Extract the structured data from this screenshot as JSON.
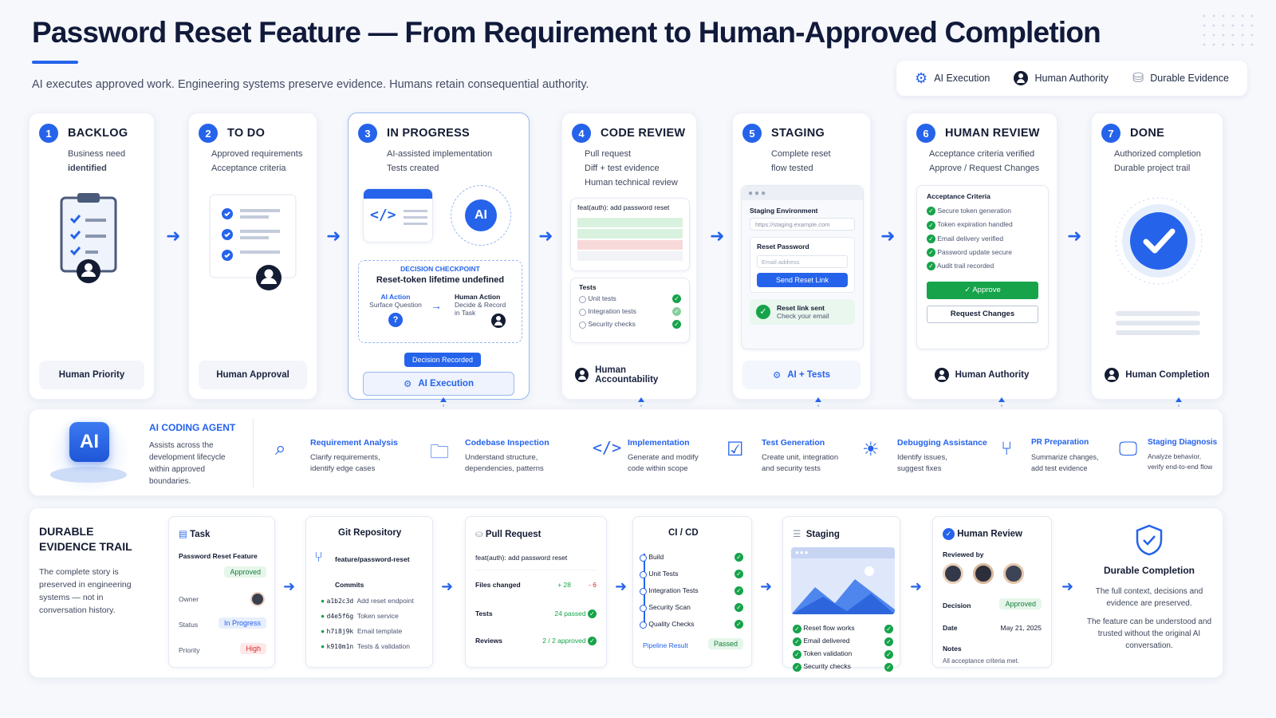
{
  "header": {
    "title": "Password Reset Feature — From Requirement to Human-Approved Completion",
    "subtitle": "AI executes approved work. Engineering systems preserve evidence. Humans retain consequential authority."
  },
  "legend": {
    "ai": "AI Execution",
    "human": "Human Authority",
    "evidence": "Durable Evidence"
  },
  "stages": {
    "backlog": {
      "num": "1",
      "title": "BACKLOG",
      "desc1": "Business need",
      "desc2": "identified",
      "footer": "Human Priority"
    },
    "todo": {
      "num": "2",
      "title": "TO DO",
      "desc1": "Approved requirements",
      "desc2": "Acceptance criteria",
      "footer": "Human Approval"
    },
    "progress": {
      "num": "3",
      "title": "IN PROGRESS",
      "desc1": "AI-assisted implementation",
      "desc2": "Tests created",
      "ai_badge": "AI",
      "cp_label": "DECISION CHECKPOINT",
      "cp_title": "Reset-token lifetime undefined",
      "ai_action": "AI Action",
      "ai_action_desc": "Surface Question",
      "human_action": "Human Action",
      "human_action_desc1": "Decide & Record",
      "human_action_desc2": "in Task",
      "recorded": "Decision Recorded",
      "footer": "AI Execution"
    },
    "review": {
      "num": "4",
      "title": "CODE REVIEW",
      "desc1": "Pull request",
      "desc2": "Diff + test evidence",
      "desc3": "Human technical review",
      "pr_title": "feat(auth): add password reset",
      "tests_label": "Tests",
      "t1": "Unit tests",
      "t2": "Integration tests",
      "t3": "Security checks",
      "footer": "Human Accountability"
    },
    "staging": {
      "num": "5",
      "title": "STAGING",
      "desc1": "Complete reset",
      "desc2": "flow tested",
      "env": "Staging Environment",
      "url": "https://staging.example.com",
      "form_title": "Reset Password",
      "email_ph": "Email address",
      "btn": "Send Reset Link",
      "sent": "Reset link sent",
      "check": "Check your email",
      "footer": "AI + Tests"
    },
    "human": {
      "num": "6",
      "title": "HUMAN REVIEW",
      "desc1": "Acceptance criteria verified",
      "desc2": "Approve / Request Changes",
      "ac_title": "Acceptance Criteria",
      "items": [
        "Secure token generation",
        "Token expiration handled",
        "Email delivery verified",
        "Password update secure",
        "Audit trail recorded"
      ],
      "approve": "Approve",
      "request": "Request Changes",
      "footer": "Human Authority"
    },
    "done": {
      "num": "7",
      "title": "DONE",
      "desc1": "Authorized completion",
      "desc2": "Durable project trail",
      "footer": "Human Completion"
    }
  },
  "agent": {
    "badge": "AI",
    "title": "AI CODING AGENT",
    "desc": "Assists across the development lifecycle within approved boundaries.",
    "caps": [
      {
        "icon": "search-icon",
        "title": "Requirement Analysis",
        "d1": "Clarify requirements,",
        "d2": "identify edge cases"
      },
      {
        "icon": "folder-search-icon",
        "title": "Codebase Inspection",
        "d1": "Understand structure,",
        "d2": "dependencies, patterns"
      },
      {
        "icon": "code-icon",
        "title": "Implementation",
        "d1": "Generate and modify",
        "d2": "code within scope"
      },
      {
        "icon": "checklist-icon",
        "title": "Test Generation",
        "d1": "Create unit, integration",
        "d2": "and security tests"
      },
      {
        "icon": "bug-icon",
        "title": "Debugging Assistance",
        "d1": "Identify issues,",
        "d2": "suggest fixes"
      },
      {
        "icon": "branch-icon",
        "title": "PR Preparation",
        "d1": "Summarize changes,",
        "d2": "add test evidence"
      },
      {
        "icon": "monitor-icon",
        "title": "Staging Diagnosis",
        "d1": "Analyze behavior,",
        "d2": "verify end-to-end flow"
      }
    ]
  },
  "trail": {
    "title1": "DURABLE",
    "title2": "EVIDENCE TRAIL",
    "desc": "The complete story is preserved in engineering systems — not in conversation history.",
    "task": {
      "h": "Task",
      "name": "Password Reset Feature",
      "approved": "Approved",
      "owner": "Owner",
      "status": "Status",
      "status_v": "In Progress",
      "priority": "Priority",
      "priority_v": "High"
    },
    "git": {
      "h": "Git Repository",
      "branch": "feature/password-reset",
      "commits": "Commits",
      "list": [
        [
          "a1b2c3d",
          "Add reset endpoint"
        ],
        [
          "d4e5f6g",
          "Token service"
        ],
        [
          "h7i8j9k",
          "Email template"
        ],
        [
          "k910m1n",
          "Tests & validation"
        ]
      ]
    },
    "pr": {
      "h": "Pull Request",
      "t": "feat(auth): add password reset",
      "files": "Files changed",
      "plus": "+ 28",
      "minus": "- 6",
      "tests": "Tests",
      "tests_v": "24 passed",
      "reviews": "Reviews",
      "reviews_v": "2 / 2 approved"
    },
    "ci": {
      "h": "CI / CD",
      "steps": [
        "Build",
        "Unit Tests",
        "Integration Tests",
        "Security Scan",
        "Quality Checks"
      ],
      "result": "Pipeline Result",
      "passed": "Passed"
    },
    "stg": {
      "h": "Staging",
      "checks": [
        "Reset flow works",
        "Email delivered",
        "Token validation",
        "Security checks"
      ]
    },
    "hr": {
      "h": "Human Review",
      "by": "Reviewed by",
      "decision": "Decision",
      "decision_v": "Approved",
      "date": "Date",
      "date_v": "May 21, 2025",
      "notes": "Notes",
      "notes_v": "All acceptance criteria met."
    },
    "dc": {
      "h": "Durable Completion",
      "d1": "The full context, decisions and evidence are preserved.",
      "d2": "The feature can be understood and trusted without the original AI conversation."
    }
  },
  "colors": {
    "accent": "#2563eb",
    "green": "#16a34a",
    "red": "#dc2626"
  }
}
